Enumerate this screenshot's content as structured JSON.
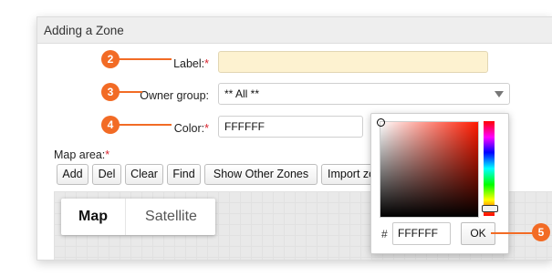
{
  "dialog": {
    "title": "Adding a Zone",
    "label_field": {
      "label": "Label:",
      "required_mark": "*",
      "value": ""
    },
    "owner_group": {
      "label": "Owner group:",
      "selected": "** All **"
    },
    "color_field": {
      "label": "Color:",
      "required_mark": "*",
      "value": "FFFFFF"
    },
    "map_area": {
      "label": "Map area:",
      "required_mark": "*"
    },
    "toolbar": {
      "add": "Add",
      "del": "Del",
      "clear": "Clear",
      "find": "Find",
      "show_other_zones": "Show Other Zones",
      "import_zones": "Import zo"
    },
    "map": {
      "map_tab": "Map",
      "satellite_tab": "Satellite"
    }
  },
  "color_picker": {
    "hash_label": "#",
    "hex_value": "FFFFFF",
    "ok_label": "OK",
    "hue_color": "#ff1a00"
  },
  "callouts": {
    "c2": "2",
    "c3": "3",
    "c4": "4",
    "c5": "5"
  },
  "colors": {
    "accent": "#f26b25",
    "required": "#d9232e",
    "label_bg": "#fdf2d0"
  }
}
